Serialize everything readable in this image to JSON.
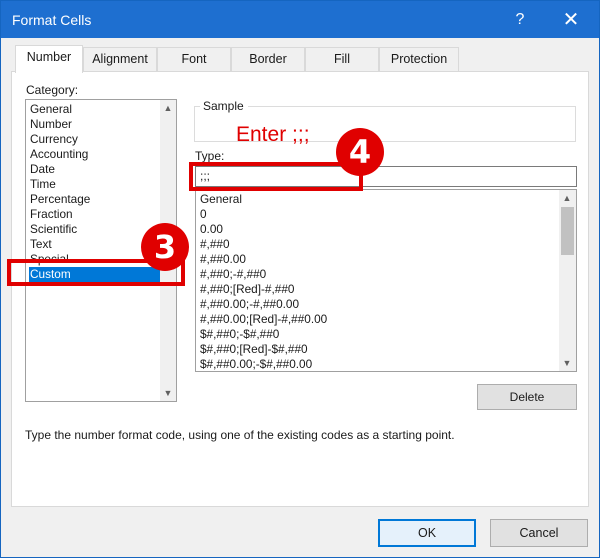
{
  "window": {
    "title": "Format Cells",
    "help_icon": "?",
    "close_icon": "✕"
  },
  "tabs": [
    {
      "label": "Number"
    },
    {
      "label": "Alignment"
    },
    {
      "label": "Font"
    },
    {
      "label": "Border"
    },
    {
      "label": "Fill"
    },
    {
      "label": "Protection"
    }
  ],
  "number_tab": {
    "category_label": "Category:",
    "categories": [
      "General",
      "Number",
      "Currency",
      "Accounting",
      "Date",
      "Time",
      "Percentage",
      "Fraction",
      "Scientific",
      "Text",
      "Special",
      "Custom"
    ],
    "selected_category": "Custom",
    "sample_label": "Sample",
    "type_label": "Type:",
    "type_value": ";;;",
    "formats": [
      "General",
      "0",
      "0.00",
      "#,##0",
      "#,##0.00",
      "#,##0;-#,##0",
      "#,##0;[Red]-#,##0",
      "#,##0.00;-#,##0.00",
      "#,##0.00;[Red]-#,##0.00",
      "$#,##0;-$#,##0",
      "$#,##0;[Red]-$#,##0",
      "$#,##0.00;-$#,##0.00"
    ],
    "delete_label": "Delete",
    "description": "Type the number format code, using one of the existing codes as a starting point."
  },
  "footer": {
    "ok_label": "OK",
    "cancel_label": "Cancel"
  },
  "annotations": {
    "step3": "3",
    "step4": "4",
    "enter_hint": "Enter ;;;",
    "color": "#e00000"
  },
  "colors": {
    "titlebar": "#1e6fd0",
    "selection": "#0078d7"
  }
}
